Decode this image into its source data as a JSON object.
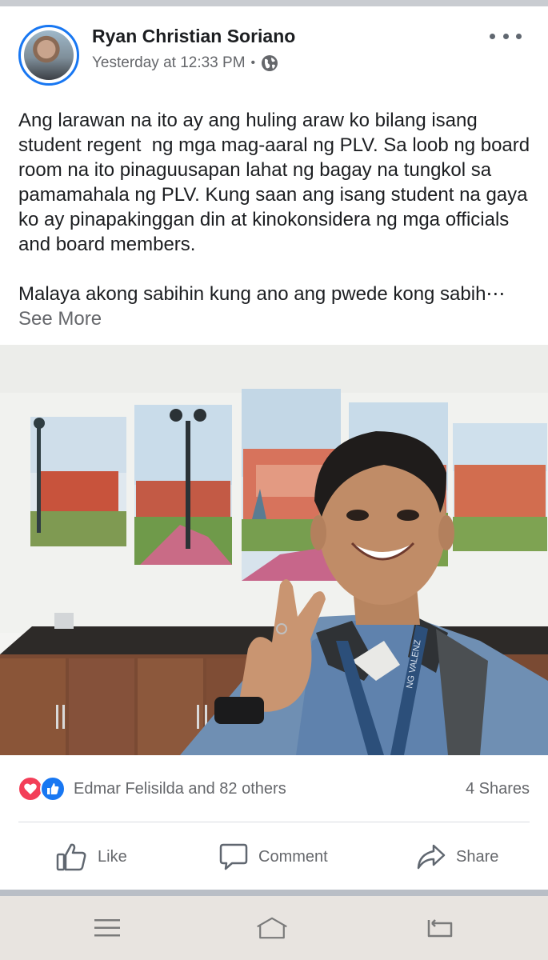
{
  "post": {
    "author": "Ryan Christian Soriano",
    "timestamp": "Yesterday at 12:33 PM",
    "separator": "•",
    "privacy_icon": "globe-icon",
    "text_paragraph_1": "Ang larawan na ito ay ang huling araw ko bilang isang student regent  ng mga mag-aaral ng PLV. Sa loob ng board room na ito pinaguusapan lahat ng bagay na tungkol sa pamamahala ng PLV. Kung saan ang isang student na gaya ko ay pinapakinggan din at kinokonsidera ng mga officials and board members.",
    "text_paragraph_2": "Malaya akong sabihin kung ano ang pwede kong sabih⋯",
    "see_more": "See More",
    "photo_lanyard_text": "NG VALENZ"
  },
  "reactions": {
    "icons": [
      "love-icon",
      "like-icon"
    ],
    "summary": "Edmar Felisilda and 82 others",
    "shares": "4 Shares"
  },
  "actions": {
    "like_label": "Like",
    "comment_label": "Comment",
    "share_label": "Share"
  },
  "system_nav": {
    "icons": [
      "menu-icon",
      "home-icon",
      "back-icon"
    ]
  },
  "colors": {
    "accent": "#1877f2",
    "love": "#f33e58",
    "secondary_text": "#65676b",
    "nav_bar": "#e8e4e0"
  }
}
